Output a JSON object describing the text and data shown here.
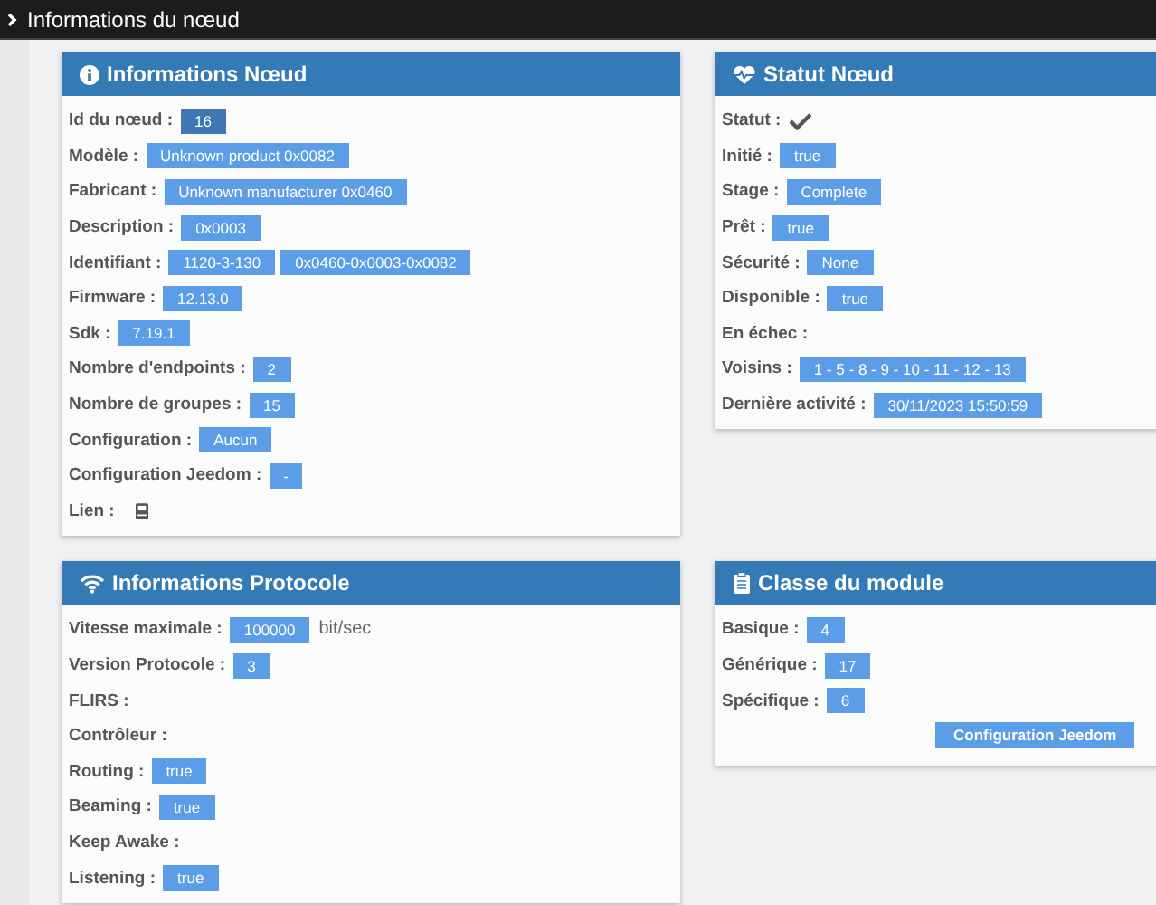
{
  "topbar": {
    "title": "Informations du nœud"
  },
  "panels": [
    {
      "title": "Informations Nœud",
      "rows": [
        {
          "kind": "strong",
          "label": "Id du nœud :",
          "values": [
            "16"
          ]
        },
        {
          "kind": "badges",
          "label": "Modèle :",
          "values": [
            "Unknown product 0x0082"
          ]
        },
        {
          "kind": "badges",
          "label": "Fabricant :",
          "values": [
            "Unknown manufacturer 0x0460"
          ]
        },
        {
          "kind": "badges",
          "label": "Description :",
          "values": [
            "0x0003"
          ]
        },
        {
          "kind": "badges",
          "label": "Identifiant :",
          "values": [
            "1120-3-130",
            "0x0460-0x0003-0x0082"
          ]
        },
        {
          "kind": "badges",
          "label": "Firmware :",
          "values": [
            "12.13.0"
          ]
        },
        {
          "kind": "badges",
          "label": "Sdk :",
          "values": [
            "7.19.1"
          ]
        },
        {
          "kind": "badges",
          "label": "Nombre d'endpoints :",
          "values": [
            "2"
          ]
        },
        {
          "kind": "badges",
          "label": "Nombre de groupes :",
          "values": [
            "15"
          ]
        },
        {
          "kind": "badges",
          "label": "Configuration :",
          "values": [
            "Aucun"
          ]
        },
        {
          "kind": "badges",
          "label": "Configuration Jeedom :",
          "values": [
            "-"
          ]
        },
        {
          "kind": "link",
          "label": "Lien :"
        }
      ]
    },
    {
      "title": "Statut Nœud",
      "rows": [
        {
          "kind": "check",
          "label": "Statut :"
        },
        {
          "kind": "badges",
          "label": "Initié :",
          "values": [
            "true"
          ]
        },
        {
          "kind": "badges",
          "label": "Stage :",
          "values": [
            "Complete"
          ]
        },
        {
          "kind": "badges",
          "label": "Prêt :",
          "values": [
            "true"
          ]
        },
        {
          "kind": "badges",
          "label": "Sécurité :",
          "values": [
            "None"
          ]
        },
        {
          "kind": "badges",
          "label": "Disponible :",
          "values": [
            "true"
          ]
        },
        {
          "kind": "empty",
          "label": "En échec :"
        },
        {
          "kind": "badges",
          "label": "Voisins :",
          "values": [
            "1 - 5 - 8 - 9 - 10 - 11 - 12 - 13"
          ]
        },
        {
          "kind": "badges",
          "label": "Dernière activité :",
          "values": [
            "30/11/2023 15:50:59"
          ]
        }
      ]
    },
    {
      "title": "Informations Protocole",
      "rows": [
        {
          "kind": "badges",
          "label": "Vitesse maximale :",
          "values": [
            "100000"
          ],
          "suffix": "bit/sec"
        },
        {
          "kind": "badges",
          "label": "Version Protocole :",
          "values": [
            "3"
          ]
        },
        {
          "kind": "empty",
          "label": "FLIRS :"
        },
        {
          "kind": "empty",
          "label": "Contrôleur :"
        },
        {
          "kind": "badges",
          "label": "Routing :",
          "values": [
            "true"
          ]
        },
        {
          "kind": "badges",
          "label": "Beaming :",
          "values": [
            "true"
          ]
        },
        {
          "kind": "empty",
          "label": "Keep Awake :"
        },
        {
          "kind": "badges",
          "label": "Listening :",
          "values": [
            "true"
          ]
        }
      ]
    },
    {
      "title": "Classe du module",
      "rows": [
        {
          "kind": "badges",
          "label": "Basique :",
          "values": [
            "4"
          ]
        },
        {
          "kind": "badges",
          "label": "Générique :",
          "values": [
            "17"
          ]
        },
        {
          "kind": "badges",
          "label": "Spécifique :",
          "values": [
            "6"
          ]
        }
      ],
      "button": "Configuration Jeedom"
    }
  ]
}
